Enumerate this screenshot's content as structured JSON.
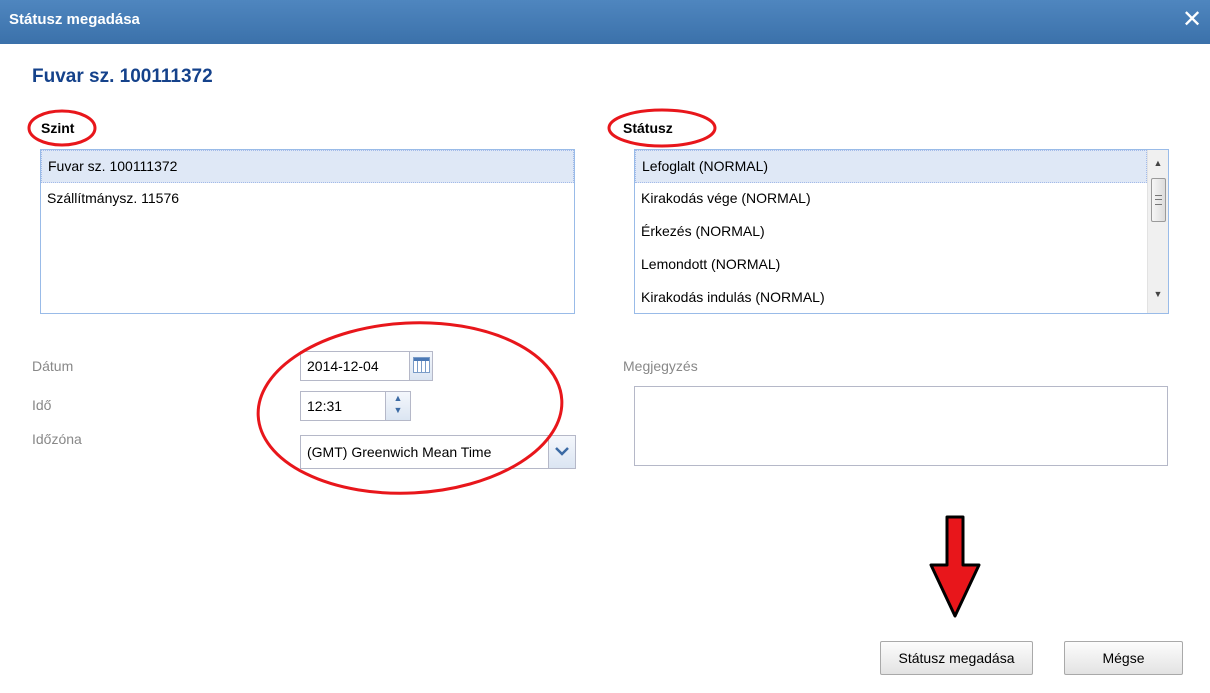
{
  "dialog": {
    "title": "Státusz megadása",
    "close_glyph": "✕"
  },
  "heading": "Fuvar sz. 100111372",
  "szint": {
    "label": "Szint",
    "items": [
      "Fuvar sz. 100111372",
      "Szállítmánysz. 11576"
    ],
    "selected_index": 0
  },
  "statusz": {
    "label": "Státusz",
    "items": [
      "Lefoglalt (NORMAL)",
      "Kirakodás vége (NORMAL)",
      "Érkezés (NORMAL)",
      "Lemondott (NORMAL)",
      "Kirakodás indulás (NORMAL)"
    ],
    "selected_index": 0
  },
  "form": {
    "datum_label": "Dátum",
    "datum_value": "2014-12-04",
    "ido_label": "Idő",
    "ido_value": "12:31",
    "idozona_label": "Időzóna",
    "idozona_value": "(GMT) Greenwich Mean Time",
    "megjegyzes_label": "Megjegyzés",
    "megjegyzes_value": ""
  },
  "buttons": {
    "submit": "Státusz megadása",
    "cancel": "Mégse"
  },
  "icons": {
    "close": "close-icon",
    "calendar": "calendar-icon",
    "spinner": "spinner-icon",
    "dropdown": "chevron-down-icon",
    "scroll_up": "arrow-up-icon",
    "scroll_down": "arrow-down-icon"
  },
  "colors": {
    "titlebar": "#3b71aa",
    "heading": "#15428b",
    "selection": "#dfe8f6",
    "annotation": "#e8161b"
  }
}
